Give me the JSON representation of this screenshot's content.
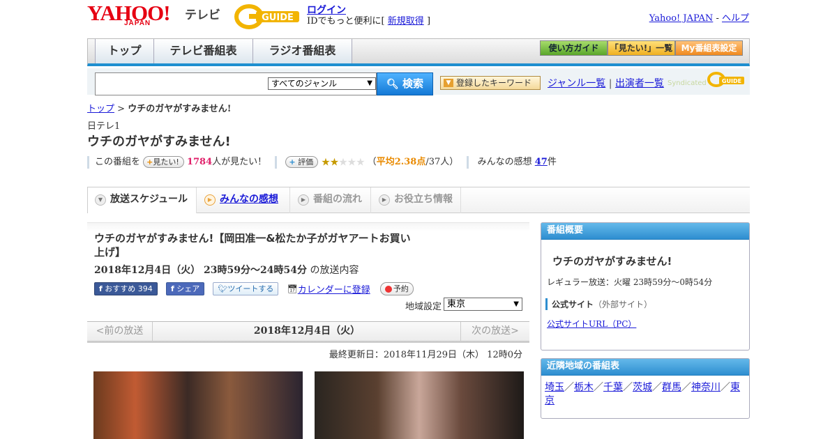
{
  "header": {
    "logo_text": "YAHOO!",
    "logo_sub": "JAPAN",
    "tv_word": "テレビ",
    "gguide_logo": "G GUIDE",
    "login": "ログイン",
    "login_sub_prefix": "IDでもっと便利に[",
    "register": "新規取得",
    "login_sub_suffix": "]",
    "yahoo_japan": "Yahoo! JAPAN",
    "dash": " - ",
    "help": "ヘルプ"
  },
  "nav": {
    "tabs": [
      "トップ",
      "テレビ番組表",
      "ラジオ番組表"
    ],
    "buttons": [
      "使い方ガイド",
      "「見たい!」一覧",
      "My番組表設定"
    ]
  },
  "search": {
    "input_value": "",
    "genre_selected": "すべてのジャンル",
    "search_button": "検索",
    "keyword_button": "登録したキーワード",
    "genre_list": "ジャンル一覧",
    "divider": "|",
    "performer_list": "出演者一覧",
    "syndicated": "Syndicated"
  },
  "breadcrumb": {
    "top": "トップ",
    "sep": " > ",
    "current": "ウチのガヤがすみません!"
  },
  "program": {
    "channel": "日テレ1",
    "title": "ウチのガヤがすみません!",
    "want_prefix": "この番組を",
    "want_button": "見たい!",
    "want_count": "1784",
    "want_suffix": "人が見たい！",
    "rate_button": "評価",
    "stars_on": "★★",
    "stars_off": "★★★",
    "avg_open": "（",
    "avg_label": "平均2.38点",
    "avg_count": "/37人",
    "avg_close": "）",
    "comments_label": "みんなの感想",
    "comments_count": "47",
    "comments_unit": "件"
  },
  "tabs": {
    "schedule": "放送スケジュール",
    "comments": "みんなの感想",
    "flow": "番組の流れ",
    "info": "お役立ち情報"
  },
  "episode": {
    "title": "ウチのガヤがすみません!【岡田准一&松たか子がガヤアートお買い上げ】",
    "date": "2018年12月4日（火） 23時59分～24時54分",
    "date_suffix": " の放送内容",
    "fb_recommend": "おすすめ",
    "fb_count": "394",
    "fb_share": "シェア",
    "tweet": "ツイートする",
    "calendar": "カレンダーに登録",
    "reserve": "予約",
    "region_label": "地域設定",
    "region_value": "東京"
  },
  "daynav": {
    "prev": "<前の放送",
    "current": "2018年12月4日（火）",
    "next": "次の放送>"
  },
  "updated": "最終更新日：2018年11月29日（木） 12時0分",
  "overview": {
    "head": "番組概要",
    "title": "ウチのガヤがすみません!",
    "regular": "レギュラー放送：火曜 23時59分～0時54分",
    "official": "公式サイト",
    "official_note": "（外部サイト）",
    "official_url": "公式サイトURL（PC）"
  },
  "nearby": {
    "head": "近隣地域の番組表",
    "regions": [
      "埼玉",
      "栃木",
      "千葉",
      "茨城",
      "群馬",
      "神奈川",
      "東京"
    ],
    "sep": "／"
  },
  "colors": {
    "yahoo_red": "#e60012",
    "accent_blue": "#2e8ed0",
    "link": "#1a1ad8",
    "want_count": "#e0206a",
    "avg_color": "#e98a00"
  }
}
